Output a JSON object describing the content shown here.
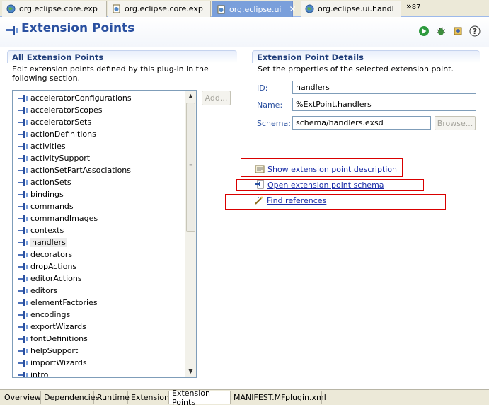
{
  "editor_tabs": [
    {
      "label": "org.eclipse.core.exp"
    },
    {
      "label": "org.eclipse.core.exp"
    },
    {
      "label": "org.eclipse.ui"
    },
    {
      "label": "org.eclipse.ui.handl"
    }
  ],
  "tab_overflow": {
    "glyph": "»",
    "count": "87"
  },
  "header": {
    "title": "Extension Points",
    "icons": [
      "run-icon",
      "debug-icon",
      "export-icon",
      "help-icon"
    ]
  },
  "left_section": {
    "title": "All Extension Points",
    "description": "Edit extension points defined by this plug-in in the following section.",
    "add_label": "Add...",
    "items": [
      "acceleratorConfigurations",
      "acceleratorScopes",
      "acceleratorSets",
      "actionDefinitions",
      "activities",
      "activitySupport",
      "actionSetPartAssociations",
      "actionSets",
      "bindings",
      "commands",
      "commandImages",
      "contexts",
      "handlers",
      "decorators",
      "dropActions",
      "editorActions",
      "editors",
      "elementFactories",
      "encodings",
      "exportWizards",
      "fontDefinitions",
      "helpSupport",
      "importWizards",
      "intro"
    ],
    "selected": "handlers"
  },
  "right_section": {
    "title": "Extension Point Details",
    "description": "Set the properties of the selected extension point.",
    "id_label": "ID:",
    "id_value": "handlers",
    "name_label": "Name:",
    "name_value": "%ExtPoint.handlers",
    "schema_label": "Schema:",
    "schema_value": "schema/handlers.exsd",
    "browse_label": "Browse..."
  },
  "links": {
    "show_description": "Show extension point description",
    "open_schema": "Open extension point schema",
    "find_references": "Find references"
  },
  "bottom_tabs": [
    "Overview",
    "Dependencies",
    "Runtime",
    "Extensions",
    "Extension Points",
    "MANIFEST.MF",
    "plugin.xml"
  ],
  "active_bottom_tab": "Extension Points",
  "colors": {
    "title": "#2a50a0",
    "link": "#1b2ea8",
    "highlight_box": "#d90000",
    "active_tab": "#7a9fdb"
  }
}
